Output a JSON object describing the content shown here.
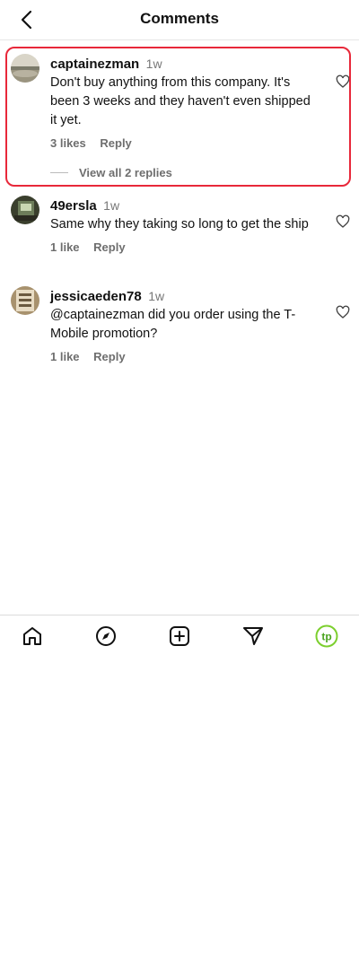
{
  "header": {
    "title": "Comments",
    "back_icon": "chevron-left-icon"
  },
  "comments": [
    {
      "username": "captainezman",
      "age": "1w",
      "text": "Don't buy anything from this company. It's been 3 weeks and they haven't even shipped it yet.",
      "likes": "3 likes",
      "reply": "Reply",
      "view_replies": "View all 2 replies",
      "highlighted": true
    },
    {
      "username": "49ersla",
      "age": "1w",
      "text": "Same why they taking so long to get the ship",
      "likes": "1 like",
      "reply": "Reply"
    },
    {
      "username": "jessicaeden78",
      "age": "1w",
      "text": "@captainezman did you order using the T-Mobile promotion?",
      "likes": "1 like",
      "reply": "Reply"
    }
  ],
  "bottom_nav": {
    "items": [
      "home-icon",
      "explore-compass-icon",
      "create-post-icon",
      "direct-message-icon",
      "profile-avatar-icon"
    ],
    "profile_initials": "tp",
    "profile_color": "#7ccf2e"
  },
  "colors": {
    "highlight": "#e8283a",
    "secondary_text": "#6e6e6e"
  }
}
